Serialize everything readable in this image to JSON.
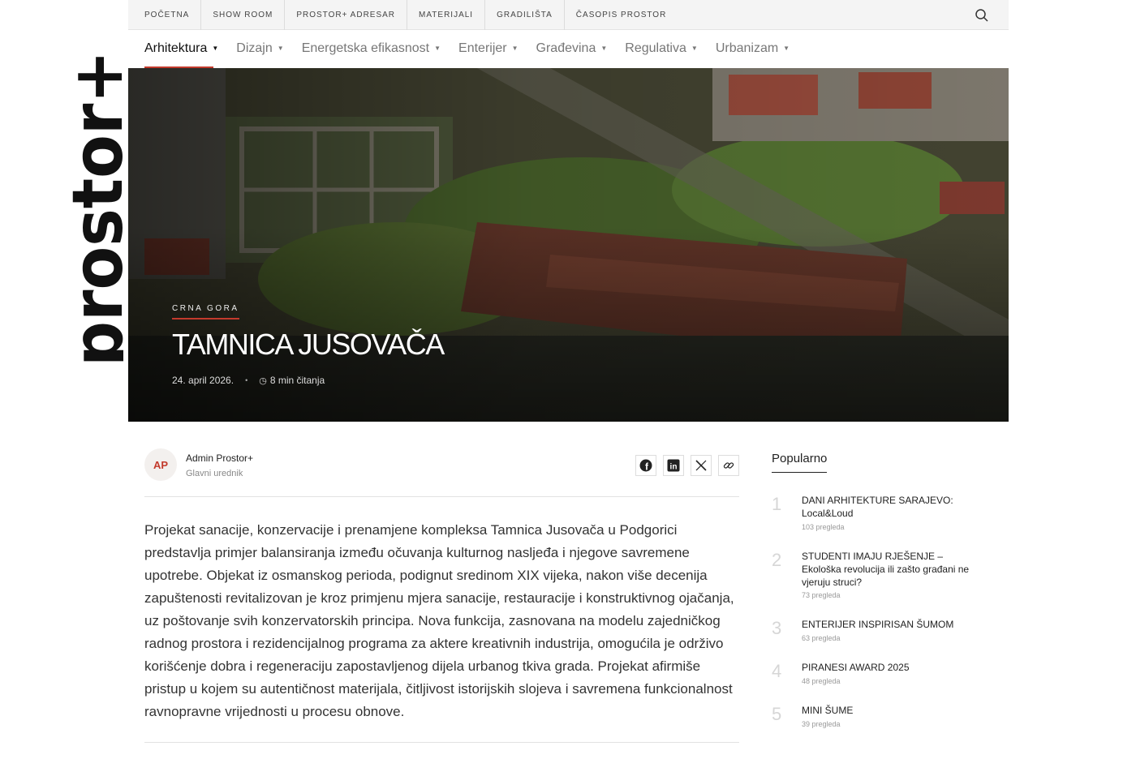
{
  "brand": {
    "logo_text": "prostor+"
  },
  "topnav": {
    "items": [
      "POČETNA",
      "SHOW ROOM",
      "PROSTOR+ ADRESAR",
      "MATERIJALI",
      "GRADILIŠTA",
      "ČASOPIS PROSTOR"
    ],
    "search_icon": "search-icon"
  },
  "categories": [
    {
      "label": "Arhitektura",
      "active": true
    },
    {
      "label": "Dizajn"
    },
    {
      "label": "Energetska efikasnost"
    },
    {
      "label": "Enterijer"
    },
    {
      "label": "Građevina"
    },
    {
      "label": "Regulativa"
    },
    {
      "label": "Urbanizam"
    }
  ],
  "hero": {
    "kicker": "CRNA GORA",
    "title": "TAMNICA JUSOVAČA",
    "date": "24. april 2026.",
    "read_time": "8 min čitanja"
  },
  "author": {
    "initials": "AP",
    "name": "Admin Prostor+",
    "role": "Glavni urednik"
  },
  "share": {
    "icons": [
      "facebook-icon",
      "linkedin-icon",
      "x-icon",
      "link-icon"
    ]
  },
  "article": {
    "body": "Projekat sanacije, konzervacije i prenamjene kompleksa Tamnica Jusovača u Podgorici predstavlja primjer balansiranja između očuvanja kulturnog nasljeđa i njegove savremene upotrebe. Objekat iz osmanskog perioda, podignut sredinom XIX vijeka, nakon više decenija zapuštenosti revitalizovan je kroz primjenu mjera sanacije, restauracije i konstruktivnog ojačanja, uz poštovanje svih konzervatorskih principa. Nova funkcija, zasnovana na modelu zajedničkog radnog prostora i rezidencijalnog programa za aktere kreativnih industrija, omogućila je održivo korišćenje dobra i regeneraciju zapostavljenog dijela urbanog tkiva grada. Projekat afirmiše pristup u kojem su autentičnost materijala, čitljivost istorijskih slojeva i savremena funkcionalnost ravnopravne vrijednosti u procesu obnove."
  },
  "sidebar": {
    "title": "Popularno",
    "items": [
      {
        "num": "1",
        "title": "DANI ARHITEKTURE SARAJEVO: Local&Loud",
        "views": "103 pregleda"
      },
      {
        "num": "2",
        "title": "STUDENTI IMAJU RJEŠENJE – Ekološka revolucija ili zašto građani ne vjeruju struci?",
        "views": "73 pregleda"
      },
      {
        "num": "3",
        "title": "ENTERIJER INSPIRISAN ŠUMOM",
        "views": "63 pregleda"
      },
      {
        "num": "4",
        "title": "PIRANESI AWARD 2025",
        "views": "48 pregleda"
      },
      {
        "num": "5",
        "title": "MINI ŠUME",
        "views": "39 pregleda"
      }
    ]
  },
  "colors": {
    "accent": "#c33a2c",
    "text": "#222222",
    "muted": "#888888"
  }
}
